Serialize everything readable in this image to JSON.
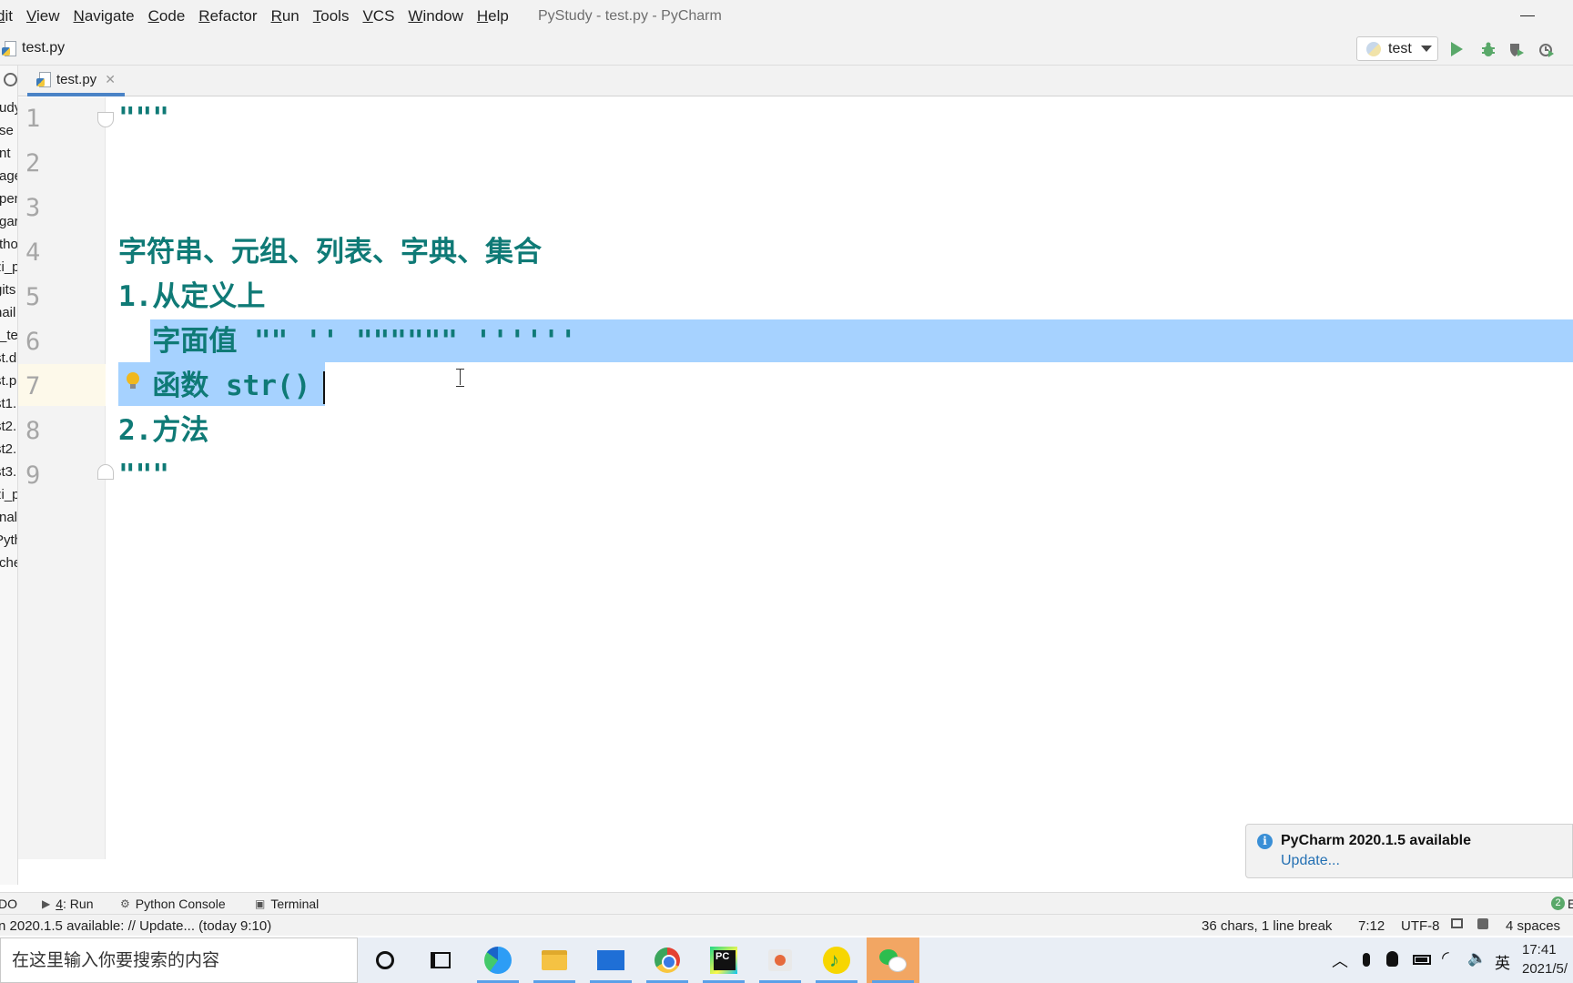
{
  "menu": {
    "items": [
      "dit",
      "View",
      "Navigate",
      "Code",
      "Refactor",
      "Run",
      "Tools",
      "VCS",
      "Window",
      "Help"
    ],
    "window_title": "PyStudy - test.py - PyCharm"
  },
  "navbar": {
    "breadcrumb": "test.py",
    "run_config": "test"
  },
  "project_tree_fragments": [
    "udy",
    "se",
    "nt",
    "age",
    "pen",
    "gar",
    "tho",
    "zi_p",
    "gits",
    "nail",
    "_te",
    "st.d",
    "st.p",
    "st1.",
    "st2.",
    "st2.",
    "st3.",
    "zi_p",
    "nal",
    "Pyth",
    "che"
  ],
  "tabs": [
    {
      "label": "test.py",
      "active": true
    }
  ],
  "editor": {
    "line_numbers": [
      "1",
      "2",
      "3",
      "4",
      "5",
      "6",
      "7",
      "8",
      "9"
    ],
    "lines": [
      "\"\"\"",
      "",
      "",
      "字符串、元组、列表、字典、集合",
      "1.从定义上",
      "  字面值 \"\" '' \"\"\"\"\"\" ''''''",
      "  函数 str()",
      "2.方法",
      "\"\"\""
    ],
    "caret_line": 7,
    "selection": "lines 6-7"
  },
  "notification": {
    "title": "PyCharm 2020.1.5 available",
    "link": "Update..."
  },
  "tool_windows": {
    "todo": "DO",
    "run_num": "4",
    "run_label": ": Run",
    "python_console": "Python Console",
    "terminal": "Terminal",
    "event_count": "2",
    "event_label": "E"
  },
  "statusbar": {
    "message": "n 2020.1.5 available: // Update... (today 9:10)",
    "chars": "36 chars, 1 line break",
    "position": "7:12",
    "encoding": "UTF-8",
    "indent": "4 spaces"
  },
  "taskbar": {
    "search_placeholder": "在这里输入你要搜索的内容",
    "ime": "英",
    "time": "17:41",
    "date": "2021/5/"
  },
  "colors": {
    "code_text": "#0f7a76",
    "selection": "#a6d2ff",
    "caret_row": "#fdf9ea",
    "run_green": "#59a869",
    "link_blue": "#2470b3"
  }
}
